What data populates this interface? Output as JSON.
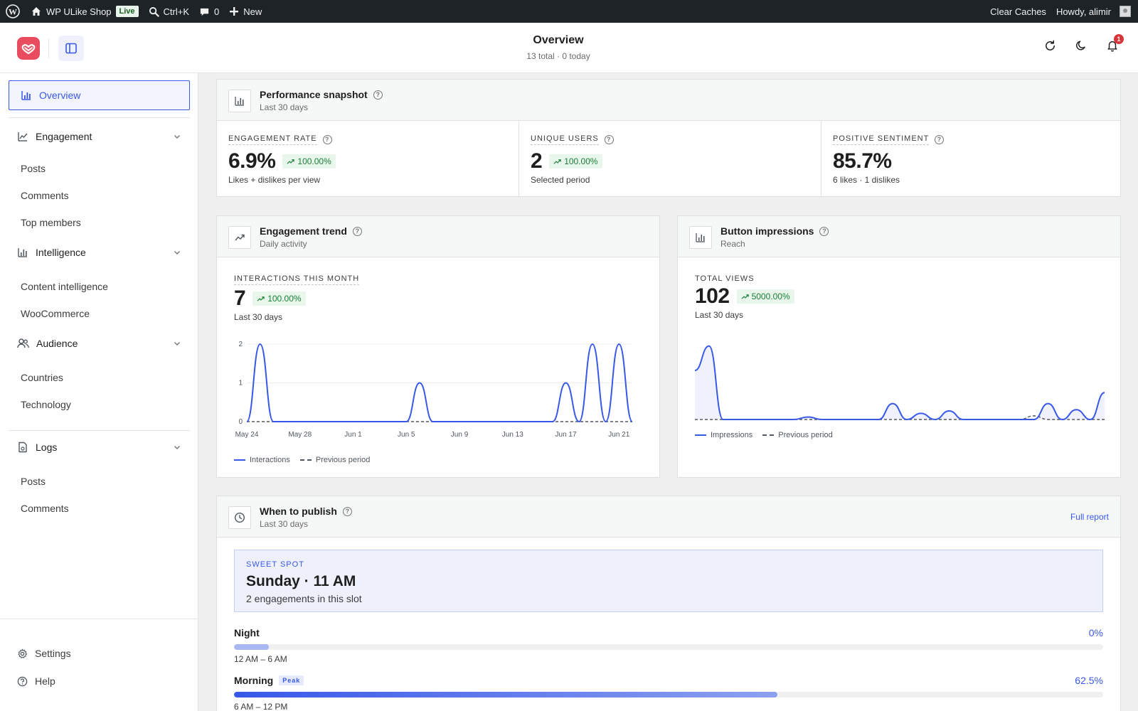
{
  "adminbar": {
    "site_name": "WP ULike Shop",
    "live_badge": "Live",
    "search_shortcut": "Ctrl+K",
    "comments_count": "0",
    "new_label": "New",
    "clear_caches": "Clear Caches",
    "howdy": "Howdy, alimir"
  },
  "header": {
    "title": "Overview",
    "subtitle": "13 total · 0 today",
    "notification_count": "1"
  },
  "sidebar": {
    "overview": "Overview",
    "engagement": {
      "label": "Engagement",
      "items": [
        "Posts",
        "Comments",
        "Top members"
      ]
    },
    "intelligence": {
      "label": "Intelligence",
      "items": [
        "Content intelligence",
        "WooCommerce"
      ]
    },
    "audience": {
      "label": "Audience",
      "items": [
        "Countries",
        "Technology"
      ]
    },
    "logs": {
      "label": "Logs",
      "items": [
        "Posts",
        "Comments"
      ]
    },
    "settings": "Settings",
    "help": "Help"
  },
  "snapshot": {
    "title": "Performance snapshot",
    "subtitle": "Last 30 days",
    "kpis": [
      {
        "label": "Engagement rate",
        "value": "6.9%",
        "trend": "100.00%",
        "sub": "Likes + dislikes per view"
      },
      {
        "label": "Unique users",
        "value": "2",
        "trend": "100.00%",
        "sub": "Selected period"
      },
      {
        "label": "Positive sentiment",
        "value": "85.7%",
        "sub": "6 likes · 1 dislikes"
      }
    ]
  },
  "trend_card": {
    "title": "Engagement trend",
    "subtitle": "Daily activity",
    "kpi_label": "Interactions this month",
    "kpi_value": "7",
    "kpi_trend": "100.00%",
    "kpi_sub": "Last 30 days",
    "legend_current": "Interactions",
    "legend_previous": "Previous period"
  },
  "impressions_card": {
    "title": "Button impressions",
    "subtitle": "Reach",
    "kpi_label": "Total views",
    "kpi_value": "102",
    "kpi_trend": "5000.00%",
    "kpi_sub": "Last 30 days",
    "legend_current": "Impressions",
    "legend_previous": "Previous period"
  },
  "publish": {
    "title": "When to publish",
    "subtitle": "Last 30 days",
    "full_report": "Full report",
    "sweet_label": "Sweet spot",
    "sweet_title": "Sunday · 11 AM",
    "sweet_sub": "2 engagements in this slot",
    "slots": [
      {
        "name": "Night",
        "pct": "0%",
        "fill": 0.04,
        "range": "12 AM – 6 AM"
      },
      {
        "name": "Morning",
        "badge": "Peak",
        "pct": "62.5%",
        "fill": 0.625,
        "range": "6 AM – 12 PM"
      }
    ]
  },
  "chart_data": [
    {
      "type": "line",
      "x": [
        "May 24",
        "May 25",
        "May 26",
        "May 27",
        "May 28",
        "May 29",
        "May 30",
        "May 31",
        "Jun 1",
        "Jun 2",
        "Jun 3",
        "Jun 4",
        "Jun 5",
        "Jun 6",
        "Jun 7",
        "Jun 8",
        "Jun 9",
        "Jun 10",
        "Jun 11",
        "Jun 12",
        "Jun 13",
        "Jun 14",
        "Jun 15",
        "Jun 16",
        "Jun 17",
        "Jun 18",
        "Jun 19",
        "Jun 20",
        "Jun 21",
        "Jun 22"
      ],
      "tick_labels": [
        "May 24",
        "May 28",
        "Jun 1",
        "Jun 5",
        "Jun 9",
        "Jun 13",
        "Jun 17",
        "Jun 21"
      ],
      "series": [
        {
          "name": "Interactions",
          "values": [
            0,
            2,
            0,
            0,
            0,
            0,
            0,
            0,
            0,
            0,
            0,
            0,
            0,
            1,
            0,
            0,
            0,
            0,
            0,
            0,
            0,
            0,
            0,
            0,
            1,
            0,
            2,
            0,
            2,
            0
          ]
        },
        {
          "name": "Previous period",
          "values": [
            0,
            0,
            0,
            0,
            0,
            0,
            0,
            0,
            0,
            0,
            0,
            0,
            0,
            0,
            0,
            0,
            0,
            0,
            0,
            0,
            0,
            0,
            0,
            0,
            0,
            0,
            0,
            0,
            0,
            0
          ]
        }
      ],
      "ylim": [
        0,
        2
      ],
      "yticks": [
        0,
        1,
        2
      ],
      "grid": true,
      "legend": "bottom-left"
    },
    {
      "type": "area",
      "x": [
        "May 24",
        "May 25",
        "May 26",
        "May 27",
        "May 28",
        "May 29",
        "May 30",
        "May 31",
        "Jun 1",
        "Jun 2",
        "Jun 3",
        "Jun 4",
        "Jun 5",
        "Jun 6",
        "Jun 7",
        "Jun 8",
        "Jun 9",
        "Jun 10",
        "Jun 11",
        "Jun 12",
        "Jun 13",
        "Jun 14",
        "Jun 15",
        "Jun 16",
        "Jun 17",
        "Jun 18",
        "Jun 19",
        "Jun 20",
        "Jun 21",
        "Jun 22"
      ],
      "series": [
        {
          "name": "Impressions",
          "values": [
            40,
            60,
            0,
            0,
            0,
            0,
            0,
            0,
            2,
            0,
            0,
            0,
            0,
            0,
            13,
            0,
            5,
            0,
            7,
            0,
            0,
            0,
            0,
            0,
            0,
            13,
            0,
            8,
            0,
            22
          ]
        },
        {
          "name": "Previous period",
          "values": [
            0,
            0,
            0,
            0,
            0,
            0,
            0,
            0,
            0,
            0,
            0,
            0,
            0,
            0,
            0,
            0,
            0,
            0,
            0,
            0,
            0,
            0,
            0,
            0,
            3,
            0,
            0,
            0,
            0,
            0
          ]
        }
      ],
      "ylim": [
        0,
        65
      ],
      "grid": false,
      "legend": "bottom-left"
    }
  ]
}
